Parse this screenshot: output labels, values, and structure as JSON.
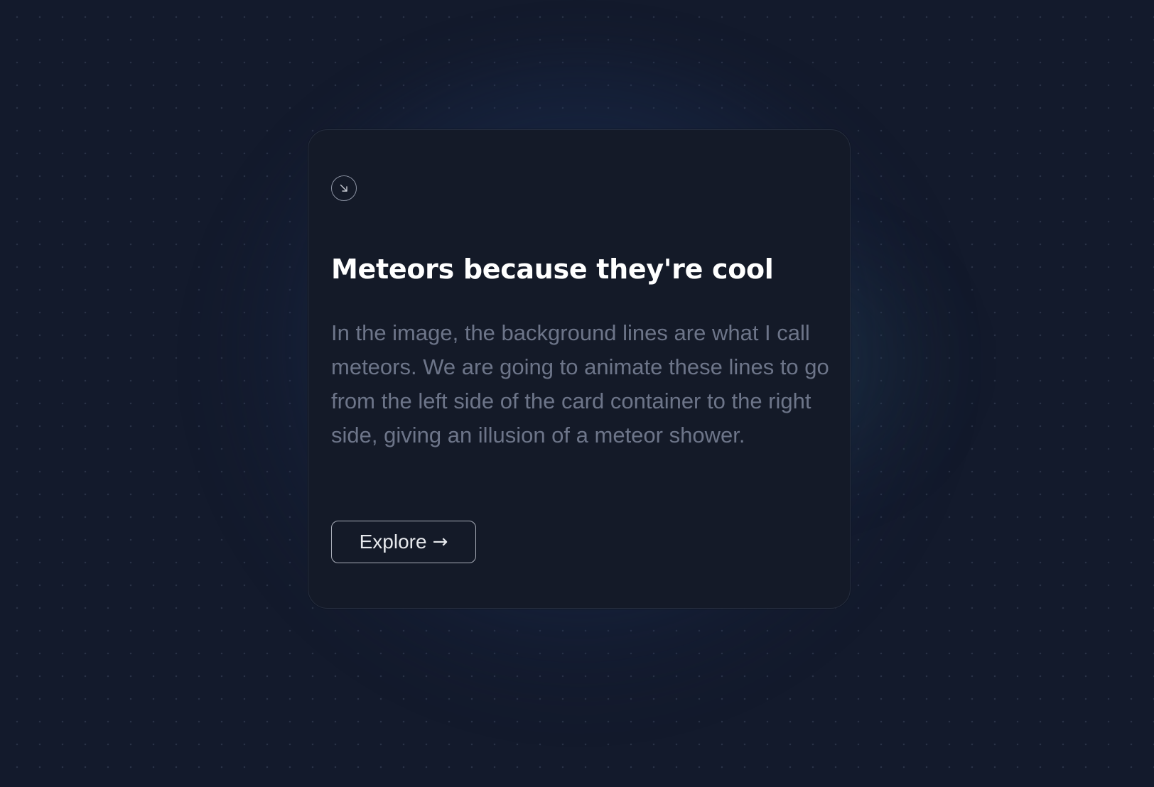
{
  "card": {
    "icon": "arrow-down-right-icon",
    "title": "Meteors because they're cool",
    "description": "In the image, the background lines are what I call meteors. We are going to animate these lines to go from the left side of the card container to the right side, giving an illusion of a meteor shower.",
    "button_label": "Explore",
    "button_arrow": "→"
  },
  "colors": {
    "background": "#131a2c",
    "card_background": "#141a28",
    "card_border": "#262e3f",
    "title": "#ffffff",
    "description": "#6d7589",
    "button_border": "#a8adb8",
    "button_text": "#e6e8ec"
  }
}
